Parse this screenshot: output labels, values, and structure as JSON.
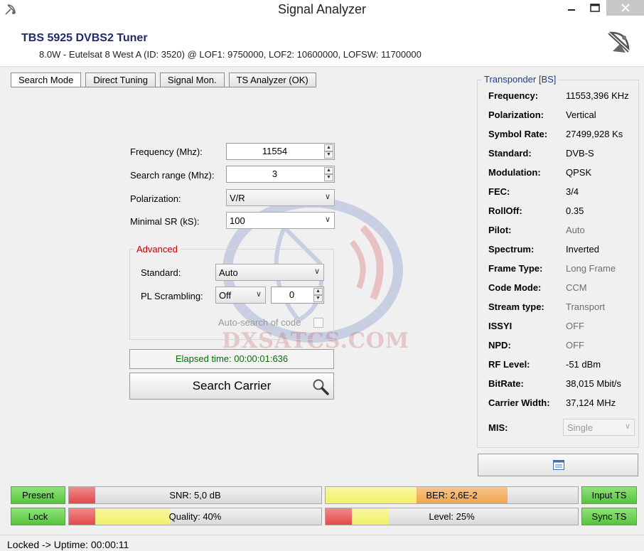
{
  "window": {
    "title": "Signal Analyzer"
  },
  "header": {
    "tuner_name": "TBS 5925 DVBS2 Tuner",
    "sat_info": "8.0W - Eutelsat 8 West A (ID: 3520) @ LOF1: 9750000, LOF2: 10600000, LOFSW: 11700000"
  },
  "tabs": [
    {
      "label": "Search Mode",
      "active": true
    },
    {
      "label": "Direct Tuning",
      "active": false
    },
    {
      "label": "Signal Mon.",
      "active": false
    },
    {
      "label": "TS Analyzer (OK)",
      "active": false
    }
  ],
  "form": {
    "frequency_label": "Frequency (Mhz):",
    "frequency_value": "11554",
    "search_range_label": "Search range (Mhz):",
    "search_range_value": "3",
    "polarization_label": "Polarization:",
    "polarization_value": "V/R",
    "minimal_sr_label": "Minimal SR (kS):",
    "minimal_sr_value": "100"
  },
  "advanced": {
    "title": "Advanced",
    "standard_label": "Standard:",
    "standard_value": "Auto",
    "pl_scrambling_label": "PL Scrambling:",
    "pl_scrambling_mode": "Off",
    "pl_scrambling_value": "0",
    "auto_search_label": "Auto-search of code"
  },
  "elapsed": "Elapsed time: 00:00:01:636",
  "search_button": "Search Carrier",
  "transponder": {
    "title": "Transponder [BS]",
    "rows": [
      {
        "key": "Frequency:",
        "value": "11553,396 KHz"
      },
      {
        "key": "Polarization:",
        "value": "Vertical"
      },
      {
        "key": "Symbol Rate:",
        "value": "27499,928 Ks"
      },
      {
        "key": "Standard:",
        "value": "DVB-S"
      },
      {
        "key": "Modulation:",
        "value": "QPSK"
      },
      {
        "key": "FEC:",
        "value": "3/4"
      },
      {
        "key": "RollOff:",
        "value": "0.35"
      },
      {
        "key": "Pilot:",
        "value": "Auto"
      },
      {
        "key": "Spectrum:",
        "value": "Inverted"
      },
      {
        "key": "Frame Type:",
        "value": "Long Frame"
      },
      {
        "key": "Code Mode:",
        "value": "CCM"
      },
      {
        "key": "Stream type:",
        "value": "Transport"
      },
      {
        "key": "ISSYI",
        "value": "OFF"
      },
      {
        "key": "NPD:",
        "value": "OFF"
      },
      {
        "key": "RF Level:",
        "value": "-51 dBm"
      },
      {
        "key": "BitRate:",
        "value": "38,015 Mbit/s"
      },
      {
        "key": "Carrier Width:",
        "value": "37,124 MHz"
      }
    ],
    "mis_label": "MIS:",
    "mis_value": "Single"
  },
  "indicators": {
    "present": "Present",
    "lock": "Lock",
    "input_ts": "Input TS",
    "sync_ts": "Sync TS"
  },
  "bars": {
    "snr": {
      "label": "SNR: 5,0 dB"
    },
    "quality": {
      "label": "Quality: 40%",
      "percent": 40
    },
    "ber": {
      "label": "BER: 2,6E-2"
    },
    "level": {
      "label": "Level: 25%",
      "percent": 25
    }
  },
  "status": "Locked -> Uptime: 00:00:11",
  "watermark": "DXSATCS.COM",
  "colors": {
    "green_indicator": "#6fd35a",
    "bar_red": "#e24a4a",
    "bar_yellow": "#f2f06a",
    "bar_orange": "#f0a64f",
    "accent_blue": "#1f3b8f",
    "advanced_red": "#c00000"
  }
}
